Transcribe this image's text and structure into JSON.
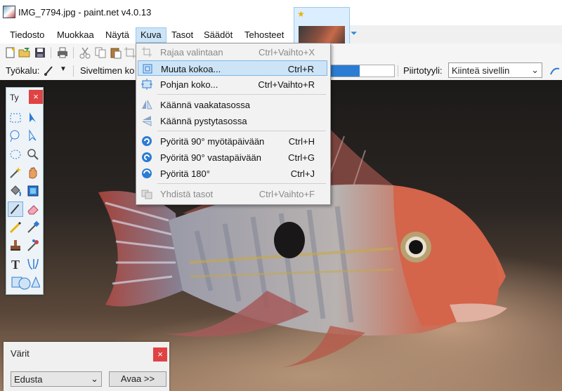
{
  "window": {
    "title": "IMG_7794.jpg - paint.net v4.0.13"
  },
  "menu": {
    "items": [
      "Tiedosto",
      "Muokkaa",
      "Näytä",
      "Kuva",
      "Tasot",
      "Säädöt",
      "Tehosteet"
    ],
    "active": "Kuva"
  },
  "image_tab": {
    "starred": true
  },
  "tool_options": {
    "tool_label": "Työkalu:",
    "brush_label": "Siveltimen ko",
    "progress_fraction": 0.45,
    "fill_label": "Piirtotyyli:",
    "fill_value": "Kiinteä sivellin"
  },
  "dropdown": {
    "items": [
      {
        "label": "Rajaa valintaan",
        "shortcut": "Ctrl+Vaihto+X",
        "disabled": true,
        "icon": "crop-icon"
      },
      {
        "label": "Muuta kokoa...",
        "shortcut": "Ctrl+R",
        "highlighted": true,
        "icon": "resize-icon"
      },
      {
        "label": "Pohjan koko...",
        "shortcut": "Ctrl+Vaihto+R",
        "icon": "canvas-size-icon"
      },
      {
        "label": "Käännä vaakatasossa",
        "shortcut": "",
        "icon": "flip-horizontal-icon"
      },
      {
        "label": "Käännä pystytasossa",
        "shortcut": "",
        "icon": "flip-vertical-icon"
      },
      {
        "label": "Pyöritä 90° myötäpäivään",
        "shortcut": "Ctrl+H",
        "icon": "rotate-cw-icon"
      },
      {
        "label": "Pyöritä 90° vastapäivään",
        "shortcut": "Ctrl+G",
        "icon": "rotate-ccw-icon"
      },
      {
        "label": "Pyöritä 180°",
        "shortcut": "Ctrl+J",
        "icon": "rotate-180-icon"
      },
      {
        "label": "Yhdistä tasot",
        "shortcut": "Ctrl+Vaihto+F",
        "disabled": true,
        "icon": "flatten-icon"
      }
    ]
  },
  "tools_panel": {
    "title": "Ty",
    "close": "×"
  },
  "colors_panel": {
    "title": "Värit",
    "close": "×",
    "select_value": "Edusta",
    "button_label": "Avaa >>"
  },
  "colors": {
    "accent": "#2b7cd3",
    "close_red": "#e04343",
    "highlight": "#cde4f7"
  }
}
